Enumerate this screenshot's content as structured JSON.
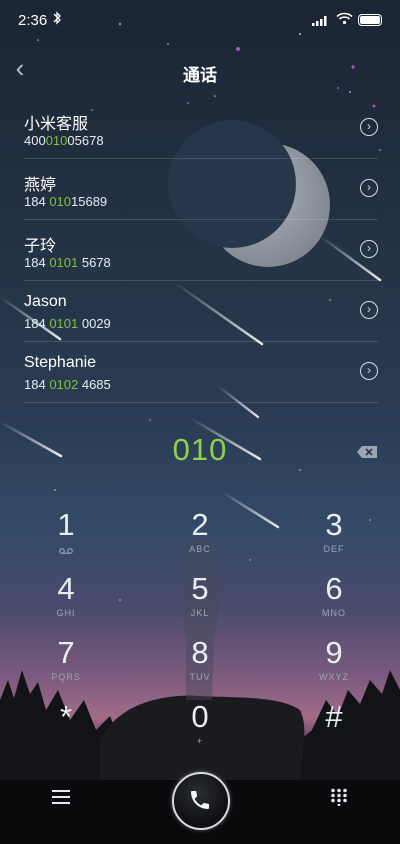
{
  "status": {
    "time": "2:36",
    "bluetooth_icon": "bluetooth-icon"
  },
  "header": {
    "title": "通话",
    "back_icon": "chevron-left-icon"
  },
  "contacts": [
    {
      "name": "小米客服",
      "num_pre": "400",
      "num_hl": "010",
      "num_post": "05678"
    },
    {
      "name": "燕婷",
      "num_pre": "184 ",
      "num_hl": "010",
      "num_post": "15689"
    },
    {
      "name": "子玲",
      "num_pre": "184 ",
      "num_hl": "0101",
      "num_post": " 5678"
    },
    {
      "name": "Jason",
      "num_pre": "184 ",
      "num_hl": "0101",
      "num_post": " 0029"
    },
    {
      "name": "Stephanie",
      "num_pre": "184 ",
      "num_hl": "0102",
      "num_post": " 4685"
    }
  ],
  "dial": {
    "number": "010"
  },
  "keypad": [
    {
      "digit": "1",
      "letters": ""
    },
    {
      "digit": "2",
      "letters": "ABC"
    },
    {
      "digit": "3",
      "letters": "DEF"
    },
    {
      "digit": "4",
      "letters": "GHI"
    },
    {
      "digit": "5",
      "letters": "JKL"
    },
    {
      "digit": "6",
      "letters": "MNO"
    },
    {
      "digit": "7",
      "letters": "PQRS"
    },
    {
      "digit": "8",
      "letters": "TUV"
    },
    {
      "digit": "9",
      "letters": "WXYZ"
    },
    {
      "digit": "*",
      "letters": ""
    },
    {
      "digit": "0",
      "letters": "+"
    },
    {
      "digit": "#",
      "letters": ""
    }
  ],
  "colors": {
    "accent_green": "#8fd14a"
  }
}
